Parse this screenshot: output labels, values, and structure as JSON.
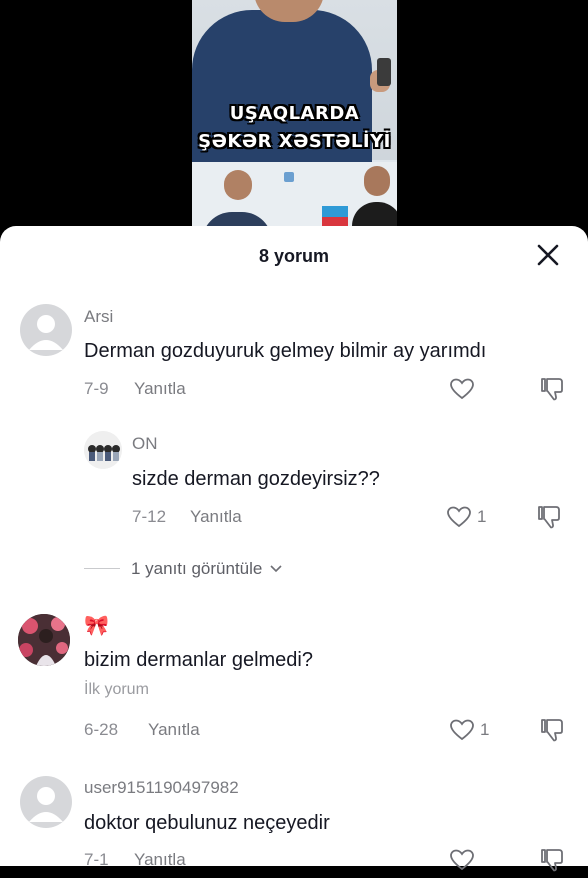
{
  "video": {
    "caption_line1": "UŞAQLARDA",
    "caption_line2": "ŞƏKƏR XƏSTƏLİYİ"
  },
  "sheet": {
    "title": "8 yorum",
    "close_icon": "close-icon"
  },
  "comments": [
    {
      "username": "Arsi",
      "text": "Derman gozduyuruk gelmey bilmir ay yarımdı",
      "date": "7-9",
      "reply_label": "Yanıtla",
      "likes": ""
    },
    {
      "username": "ON",
      "text": "sizde derman gozdeyirsiz??",
      "date": "7-12",
      "reply_label": "Yanıtla",
      "likes": "1"
    },
    {
      "username": "🎀",
      "text": "bizim dermanlar gelmedi?",
      "badge": "İlk yorum",
      "date": "6-28",
      "reply_label": "Yanıtla",
      "likes": "1"
    },
    {
      "username": "user9151190497982",
      "text": "doktor qebulunuz neçeyedir",
      "date": "7-1",
      "reply_label": "Yanıtla",
      "likes": ""
    }
  ],
  "view_replies": "1 yanıtı görüntüle",
  "colors": {
    "text": "#161823",
    "muted": "#7a7b80",
    "avatar_default": "#d6d7da"
  }
}
